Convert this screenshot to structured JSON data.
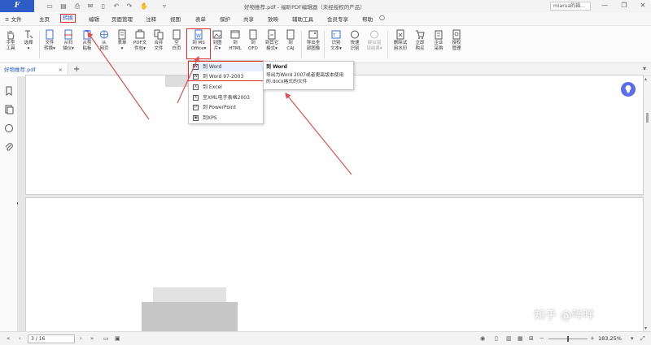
{
  "titlebar": {
    "logo": "F",
    "doc_title": "好物推荐.pdf - 福昕PDF编辑器（未经授权的产品）",
    "user": "miarua的福...",
    "minimize": "—",
    "restore": "❐",
    "close": "✕"
  },
  "menu": {
    "items": [
      "≡ 文件",
      "主页",
      "转换",
      "编辑",
      "页面管理",
      "注释",
      "视图",
      "表单",
      "保护",
      "共享",
      "放映",
      "辅助工具",
      "会员专享",
      "帮助"
    ],
    "active": "转换"
  },
  "ribbon": {
    "buttons": [
      {
        "label": "手型\n工具"
      },
      {
        "label": "选择\n▾"
      },
      {
        "label": "文件\n转换▾"
      },
      {
        "label": "从扫\n描仪▾"
      },
      {
        "label": "从剪\n贴板"
      },
      {
        "label": "从\n网页"
      },
      {
        "label": "表单\n▾"
      },
      {
        "label": "PDF文\n件包▾"
      },
      {
        "label": "合并\n文件"
      },
      {
        "label": "空\n白页"
      },
      {
        "label": "到 MS\nOffice▾"
      },
      {
        "label": "到图\n片▾"
      },
      {
        "label": "到\nHTML"
      },
      {
        "label": "到\nOFD"
      },
      {
        "label": "到其它\n格式▾"
      },
      {
        "label": "到\nCAJ"
      },
      {
        "label": "导出全\n部图像"
      },
      {
        "label": "识别\n文本▾"
      },
      {
        "label": "快速\n识别"
      },
      {
        "label": "疑似错\n误结果▾"
      },
      {
        "label": "删除试\n用水印"
      },
      {
        "label": "立即\n购买"
      },
      {
        "label": "企业\n采购"
      },
      {
        "label": "授权\n管理"
      }
    ]
  },
  "tab": {
    "name": "好物推荐.pdf",
    "close": "×",
    "add": "+"
  },
  "dropdown": {
    "items": [
      {
        "label": "到 Word",
        "icon": "W"
      },
      {
        "label": "到 Word 97-2003",
        "icon": "W"
      },
      {
        "label": "到 Excel",
        "icon": "X"
      },
      {
        "label": "至XML电子表格2003",
        "icon": "X"
      },
      {
        "label": "到 PowerPoint",
        "icon": "P"
      },
      {
        "label": "到XPS",
        "icon": "▣"
      }
    ]
  },
  "tooltip": {
    "title": "到 Word",
    "desc": "导出为Word 2007或者更高版本使用的.docx格式的文件"
  },
  "status": {
    "first": "«",
    "prev": "‹",
    "page": "3 / 16",
    "next": "›",
    "last": "»",
    "zoom": "183.25%",
    "zoom_out": "−",
    "zoom_in": "+"
  },
  "watermark": "知乎 @咩咩",
  "colors": {
    "accent": "#2d5cc6",
    "highlight": "#e02f2f"
  }
}
